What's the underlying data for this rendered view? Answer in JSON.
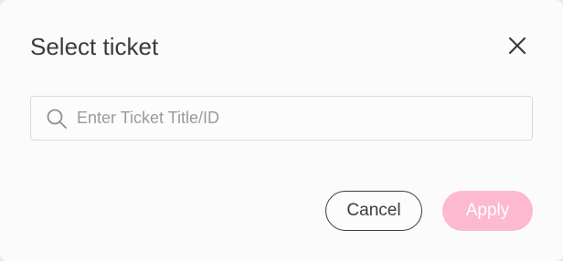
{
  "dialog": {
    "title": "Select ticket",
    "close_icon": "close-icon",
    "search": {
      "icon": "search-icon",
      "placeholder": "Enter Ticket Title/ID",
      "value": ""
    },
    "actions": {
      "cancel_label": "Cancel",
      "apply_label": "Apply"
    },
    "colors": {
      "text": "#3b3b3d",
      "apply_disabled_bg": "#fdb9cf",
      "border": "#d9d8dc",
      "placeholder": "#9a999e"
    }
  }
}
